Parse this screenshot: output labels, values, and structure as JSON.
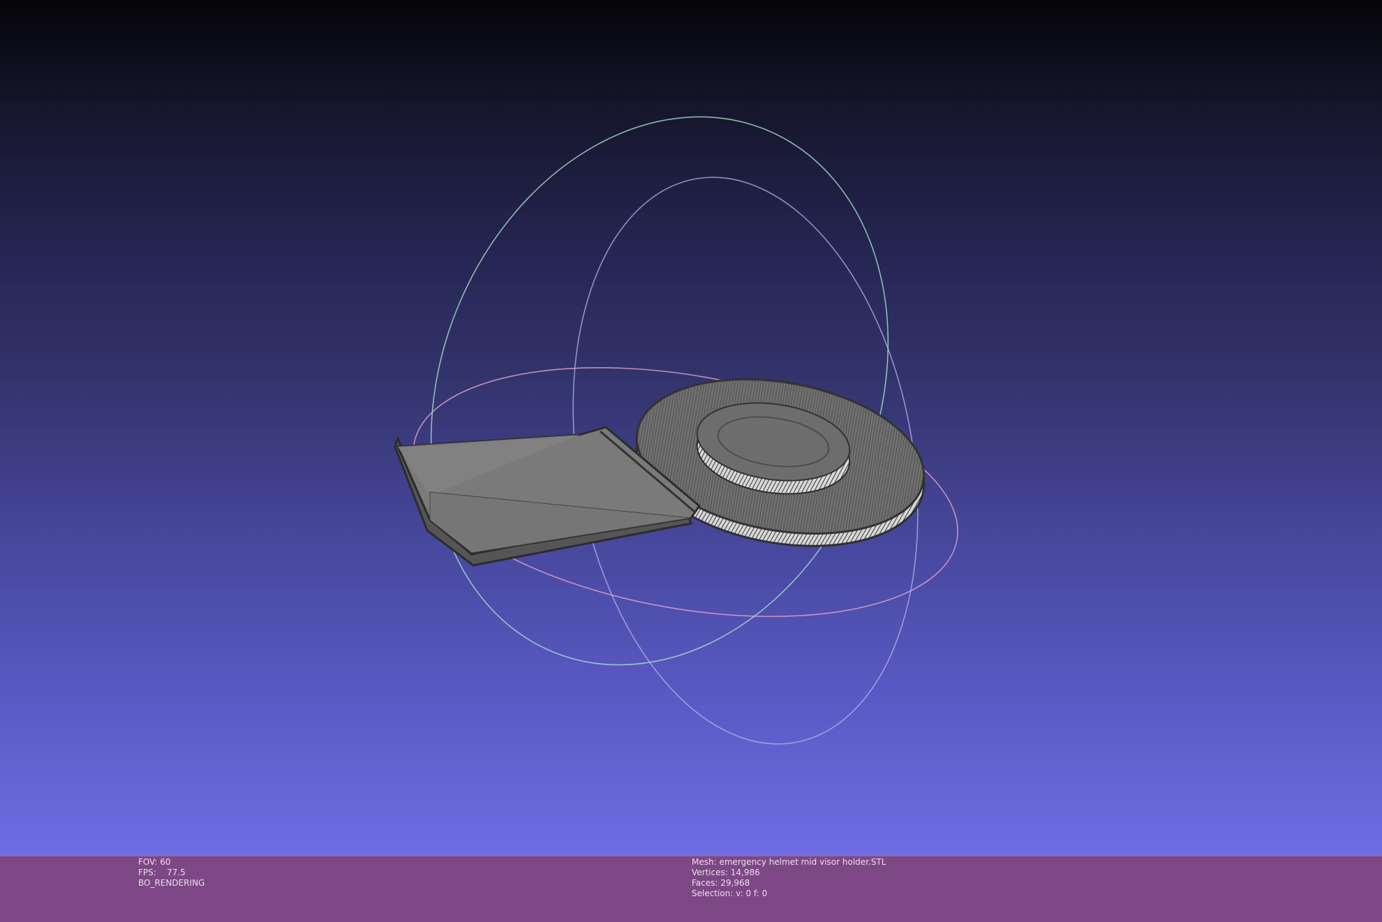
{
  "colors": {
    "background_top": "#050508",
    "background_bottom": "#6e6ee2",
    "status_bar": "#7e4786",
    "status_text": "#e9e0ec",
    "mesh_fill": "#7a7a7a",
    "mesh_edge": "#3b3b3b",
    "trackball_red": "#d9a0c6",
    "trackball_green": "#a8e2c8",
    "trackball_blue": "#b4b4e8"
  },
  "viewport": {
    "model_name": "emergency helmet mid visor holder",
    "trackball_icon": "trackball-rings-icon"
  },
  "status": {
    "render": {
      "fov": "FOV: 60",
      "fps": "FPS:    77.5",
      "mode": "BO_RENDERING"
    },
    "mesh": {
      "name": "Mesh: emergency helmet mid visor holder.STL",
      "vertices": "Vertices: 14,986",
      "faces": "Faces: 29,968",
      "selection": "Selection: v: 0 f: 0"
    }
  }
}
